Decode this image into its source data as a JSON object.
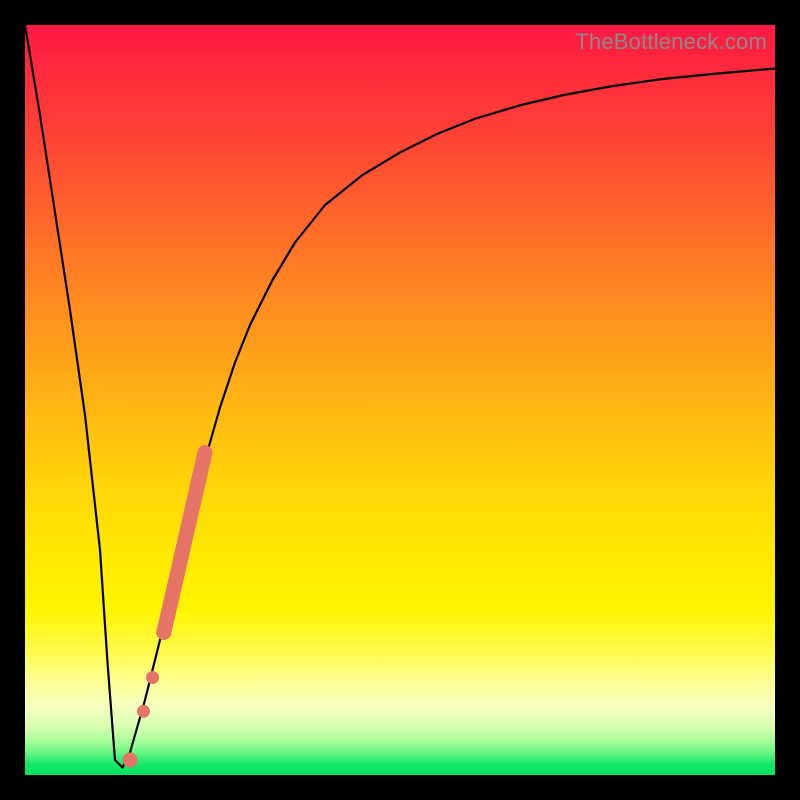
{
  "watermark": "TheBottleneck.com",
  "colors": {
    "curve_stroke": "#000000",
    "dot_fill": "#e57368",
    "frame_bg": "#000000"
  },
  "chart_data": {
    "type": "line",
    "title": "",
    "xlabel": "",
    "ylabel": "",
    "xlim": [
      0,
      100
    ],
    "ylim": [
      0,
      100
    ],
    "series": [
      {
        "name": "bottleneck-curve",
        "x": [
          0,
          2,
          4,
          6,
          8,
          10,
          11,
          12,
          13,
          14,
          16,
          18,
          20,
          22,
          24,
          26,
          28,
          30,
          33,
          36,
          40,
          45,
          50,
          55,
          60,
          66,
          72,
          78,
          85,
          92,
          100
        ],
        "y": [
          100,
          88,
          75,
          62,
          48,
          30,
          15,
          2,
          1,
          3,
          10,
          18,
          26,
          34,
          42,
          49,
          55,
          60,
          66,
          71,
          76,
          80,
          83,
          85.5,
          87.5,
          89.3,
          90.7,
          91.8,
          92.8,
          93.5,
          94.2
        ]
      }
    ],
    "dots": {
      "name": "highlight-dots",
      "points": [
        {
          "x": 14.0,
          "y": 2.0
        },
        {
          "x": 15.8,
          "y": 8.5
        },
        {
          "x": 17.0,
          "y": 13.0
        },
        {
          "x": 18.5,
          "y": 19.0
        },
        {
          "x": 19.2,
          "y": 22.0
        },
        {
          "x": 20.0,
          "y": 25.5
        },
        {
          "x": 20.8,
          "y": 29.0
        },
        {
          "x": 21.6,
          "y": 32.5
        },
        {
          "x": 22.4,
          "y": 36.0
        },
        {
          "x": 23.2,
          "y": 39.5
        },
        {
          "x": 24.0,
          "y": 43.0
        }
      ]
    }
  }
}
